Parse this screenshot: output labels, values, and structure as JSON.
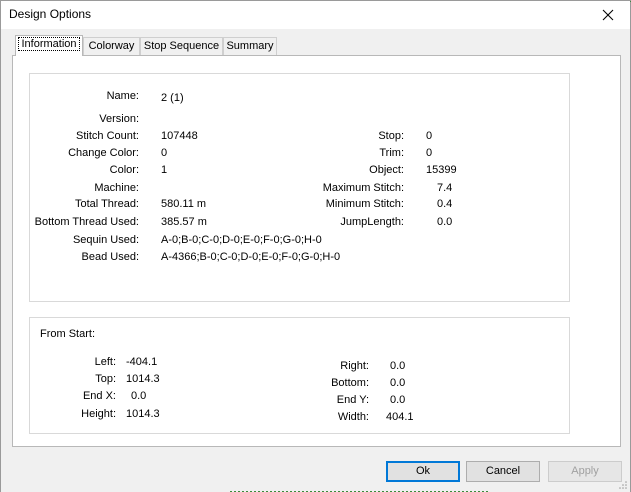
{
  "window": {
    "title": "Design Options",
    "close_icon": "close-icon"
  },
  "tabs": [
    {
      "label": "Information",
      "active": true
    },
    {
      "label": "Colorway",
      "active": false
    },
    {
      "label": "Stop Sequence",
      "active": false
    },
    {
      "label": "Summary",
      "active": false
    }
  ],
  "info": {
    "name": {
      "label": "Name:",
      "value": "2 (1)"
    },
    "version": {
      "label": "Version:",
      "value": ""
    },
    "stitch_count": {
      "label": "Stitch Count:",
      "value": "107448"
    },
    "change_color": {
      "label": "Change Color:",
      "value": "0"
    },
    "color": {
      "label": "Color:",
      "value": "1"
    },
    "machine": {
      "label": "Machine:",
      "value": ""
    },
    "total_thread": {
      "label": "Total Thread:",
      "value": "580.11 m"
    },
    "bottom_thread": {
      "label": "Bottom Thread Used:",
      "value": "385.57 m"
    },
    "sequin_used": {
      "label": "Sequin Used:",
      "value": "A-0;B-0;C-0;D-0;E-0;F-0;G-0;H-0"
    },
    "bead_used": {
      "label": "Bead Used:",
      "value": "A-4366;B-0;C-0;D-0;E-0;F-0;G-0;H-0"
    },
    "stop": {
      "label": "Stop:",
      "value": "0"
    },
    "trim": {
      "label": "Trim:",
      "value": "0"
    },
    "object": {
      "label": "Object:",
      "value": "15399"
    },
    "max_stitch": {
      "label": "Maximum Stitch:",
      "value": "7.4"
    },
    "min_stitch": {
      "label": "Minimum Stitch:",
      "value": "0.4"
    },
    "jump_length": {
      "label": "JumpLength:",
      "value": "0.0"
    }
  },
  "from_start": {
    "heading": "From Start:",
    "left": {
      "label": "Left:",
      "value": "-404.1"
    },
    "top": {
      "label": "Top:",
      "value": "1014.3"
    },
    "end_x": {
      "label": "End X:",
      "value": "0.0"
    },
    "height": {
      "label": "Height:",
      "value": "1014.3"
    },
    "right": {
      "label": "Right:",
      "value": "0.0"
    },
    "bottom": {
      "label": "Bottom:",
      "value": "0.0"
    },
    "end_y": {
      "label": "End Y:",
      "value": "0.0"
    },
    "width": {
      "label": "Width:",
      "value": "404.1"
    }
  },
  "buttons": {
    "ok": "Ok",
    "cancel": "Cancel",
    "apply": "Apply"
  },
  "colors": {
    "focus_border": "#0078d7",
    "disabled_text": "#a0a0a0"
  }
}
